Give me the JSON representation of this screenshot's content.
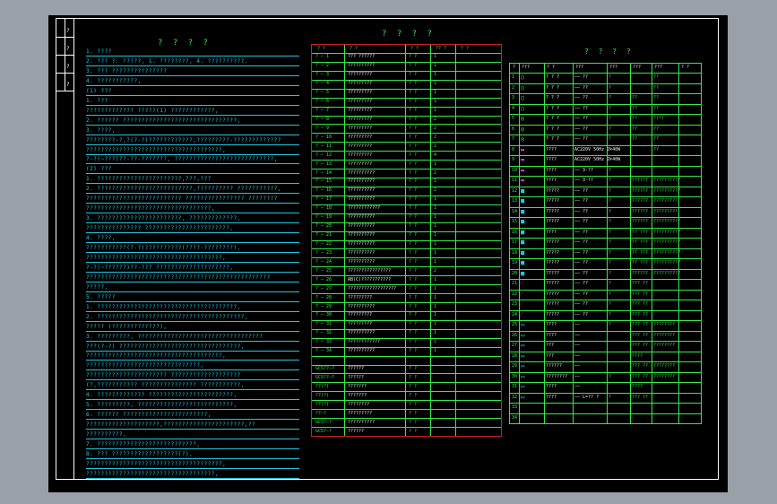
{
  "left_panel": {
    "title": "? ? ? ?",
    "side_labels": [
      "?",
      "?",
      "?",
      "?"
    ],
    "lines": [
      "1.  ????",
      "2.  ???    ?:    ?????,     1.  ????????,     4.  ??????????.",
      "3.  ???    ???????????????",
      "4.  ???????????,",
      "(1)  ???",
      "1.  ???",
      "     ????????????? ?????(1)         ????????????,",
      "2.  ??????  ???????????????????????????????,",
      "3.  ????,",
      "     ????????-?,?(?-?)????????????,?????????-?????????????",
      "     ?????????????????????????????????????,",
      "     ?-?(~???)??-??-???????,  ???????????????????????????,",
      "(2)  ???",
      "1.  ???????????????????????,???,???",
      "2.  ??????????????????????????,??????????            ???????????,",
      "     ??????????????????????????                 ????????????????       ????????",
      "     ??????????????????????????????????,",
      "3.  ???????????????????????,              ?????????????,",
      "     ???????????????         ???????????????????????,",
      "4.  ????,",
      "     ???????????(?-?)??????????(????-????????),",
      "     ?????????????????????????????????????,",
      "     ?-?(~??????)??-???     ????????????????????,",
      "     ??????????????????????????????????????????????????",
      "     ?????,",
      "5.  ?????",
      "1.  ??????????????????????????????????????,",
      "2.  ????????????????????????????????????????,",
      "     ?????      (?????????????),",
      "3.  ?????????,        ??????????????????????????????????",
      "     ???(?-?)          ?????????????????????????????????,",
      "     ?????????????????????????????????????,",
      "     ???????????????????????????????,",
      "     ??????????????????????            ???????????????????",
      "     (?,???????????              ???????????????             ???????????,",
      "4.  ?????????????             ???????????????????????,",
      "5.  ?????????,      ??????????????????????????,",
      "6.  ??????            ???????????????????????,",
      "     ????????????????????,??????????????????????,??",
      "     ??????????,",
      "7.  ???????????????????????????,",
      "8.  ???    ??????????????????(?),",
      "     ?????????????????????????????????????,",
      "     ???????????????????????????????????,"
    ]
  },
  "middle_table": {
    "title": "? ? ? ?",
    "headers": [
      "? ?",
      "? ?",
      "? ?",
      "?? ?",
      "? ?"
    ],
    "rows": [
      [
        "? — 1",
        "???    ??????",
        "? ?",
        "1",
        ""
      ],
      [
        "? — 2",
        "??????????",
        "? ?",
        "1",
        ""
      ],
      [
        "? — 3",
        "?????????",
        "? ?",
        "1",
        ""
      ],
      [
        "? — 4",
        "?????????",
        "? ?",
        "1",
        ""
      ],
      [
        "? — 5",
        "?????????",
        "? ?",
        "1",
        ""
      ],
      [
        "? — 6",
        "?????????",
        "? ?",
        "1",
        ""
      ],
      [
        "? — 7",
        "?????????",
        "? ?",
        "1",
        ""
      ],
      [
        "? — 8",
        "?????????",
        "? ?",
        "2",
        ""
      ],
      [
        "? — 9",
        "?????????",
        "? ?",
        "2",
        ""
      ],
      [
        "? — 10",
        "?????????",
        "? ?",
        "2",
        ""
      ],
      [
        "? — 11",
        "?????????",
        "? ?",
        "2",
        ""
      ],
      [
        "? — 12",
        "?????????",
        "? ?",
        "4",
        ""
      ],
      [
        "? — 13",
        "?????????",
        "? ?",
        "1",
        ""
      ],
      [
        "? — 14",
        "??????????",
        "? ?",
        "2",
        ""
      ],
      [
        "? — 15",
        "??????????",
        "? ?",
        "1",
        ""
      ],
      [
        "? — 16",
        "??????????",
        "? ?",
        "2",
        ""
      ],
      [
        "? — 17",
        "??????????",
        "? ?",
        "1",
        ""
      ],
      [
        "? — 18",
        "????????????",
        "? ?",
        "1",
        ""
      ],
      [
        "? — 19",
        "??????????",
        "? ?",
        "1",
        ""
      ],
      [
        "? — 20",
        "??????????",
        "? ?",
        "1",
        ""
      ],
      [
        "? — 21",
        "??????????",
        "? ?",
        "1",
        ""
      ],
      [
        "? — 22",
        "??????????",
        "? ?",
        "1",
        ""
      ],
      [
        "? — 23",
        "??????????",
        "? ?",
        "1",
        ""
      ],
      [
        "? — 24",
        "??????????",
        "? ?",
        "1",
        ""
      ],
      [
        "? — 25",
        "????????????????",
        "? ?",
        "2",
        ""
      ],
      [
        "? — 26",
        "AB(C)???????????",
        "? ?",
        "1",
        ""
      ],
      [
        "? — 27",
        "??????????????????",
        "? ?",
        "1",
        ""
      ],
      [
        "? — 28",
        "?????????",
        "? ?",
        "1",
        ""
      ],
      [
        "? — 29",
        "??????????",
        "? ?",
        "1",
        ""
      ],
      [
        "? — 30",
        "?????????",
        "? ?",
        "1",
        ""
      ],
      [
        "? — 31",
        "?????????",
        "? ?",
        "1",
        ""
      ],
      [
        "? — 32",
        "??????????",
        "? ?",
        "1",
        ""
      ],
      [
        "? — 33",
        "????????????",
        "? ?",
        "1",
        ""
      ],
      [
        "? — 34",
        "??????????",
        "? ?",
        "1",
        ""
      ],
      [
        "",
        "",
        "",
        "",
        ""
      ],
      [
        "GCS??—?",
        "??????",
        "? ?",
        "",
        ""
      ],
      [
        "GCS??—?",
        "??????",
        "? ?",
        "",
        ""
      ],
      [
        "??(?)",
        "???????",
        "? ?",
        "",
        ""
      ],
      [
        "??(?)",
        "???????",
        "? ?",
        "",
        ""
      ],
      [
        "??(?)",
        "????????",
        "? ?",
        "",
        ""
      ],
      [
        "??—?",
        "?????????",
        "? ?",
        "",
        ""
      ],
      [
        "GCS?—?",
        "??????????",
        "? ?",
        "",
        ""
      ],
      [
        "GCS?—?",
        "??????",
        "? ?",
        "",
        ""
      ]
    ]
  },
  "right_table": {
    "title": "? ? ? ?",
    "headers": [
      "?",
      "???",
      "?    ?",
      "???",
      "???",
      "???",
      "???",
      "? ?"
    ],
    "rows": [
      [
        "1",
        "○",
        "? ? ?",
        "—— ??",
        "?",
        "",
        "??"
      ],
      [
        "2",
        "○",
        "? ? ?",
        "—— ??",
        "?",
        "",
        "??"
      ],
      [
        "3",
        "○",
        "? ? ?",
        "—— ??",
        "?",
        "??",
        "??"
      ],
      [
        "4",
        "○",
        "? ? ?",
        "—— ??",
        "?",
        "??",
        "??"
      ],
      [
        "5",
        "◎",
        "? ? ?",
        "—— ??",
        "?",
        "??",
        "?(?)"
      ],
      [
        "6",
        "◎",
        "? ? ?",
        "—— ??",
        "?",
        "??",
        "??"
      ],
      [
        "7",
        "◎",
        "? ? ?",
        "—— ??",
        "?",
        "??",
        "??"
      ],
      [
        "8",
        "▬",
        "????",
        "AC220V 50Hz 2×40W",
        "?",
        "",
        "??"
      ],
      [
        "9",
        "▬",
        "????",
        "AC220V 50Hz 2×40W",
        "?",
        "",
        ""
      ],
      [
        "10",
        "▬",
        "????",
        "—— 3-??",
        "?",
        "",
        ""
      ],
      [
        "11",
        "▬",
        "????",
        "—— 3-??",
        "?",
        "??????",
        "??????????"
      ],
      [
        "12",
        "■",
        "?????",
        "—— ??",
        "?",
        "??????",
        "??????????"
      ],
      [
        "13",
        "■",
        "?????",
        "—— ??",
        "?",
        "??????",
        "?????????"
      ],
      [
        "14",
        "■",
        "?????",
        "—— ??",
        "?",
        "??????",
        "?????????"
      ],
      [
        "15",
        "■",
        "?????",
        "—— ??",
        "?",
        "??????",
        "??????????"
      ],
      [
        "16",
        "■",
        "????",
        "—— ??",
        "?",
        "?? ???",
        "??????????"
      ],
      [
        "17",
        "■",
        "?????",
        "—— ??",
        "?",
        "?? ???",
        "??????????"
      ],
      [
        "18",
        "■",
        "?????",
        "—— ??",
        "?",
        "?? ???",
        "??????????"
      ],
      [
        "19",
        "■",
        "?????",
        "—— ??",
        "?",
        "?? ???",
        "??????????"
      ],
      [
        "20",
        "■",
        "?????",
        "—— ??",
        "?",
        "??????",
        "??????????"
      ],
      [
        "21",
        "⁄",
        "?????",
        "—— ??",
        "?",
        "??? ??",
        ""
      ],
      [
        "22",
        "⁄",
        "?????",
        "—— ??",
        "?",
        "??? ??",
        ""
      ],
      [
        "23",
        "⁄",
        "?????",
        "—— ??",
        "?",
        "??? ??",
        ""
      ],
      [
        "24",
        "⁄",
        "?????",
        "—— ??",
        "?",
        "??? ??",
        ""
      ],
      [
        "25",
        "▭",
        "????",
        "——",
        "?",
        "??? ??",
        "????????"
      ],
      [
        "26",
        "▭",
        "????",
        "——",
        "",
        "??? ??",
        "????????"
      ],
      [
        "27",
        "▭",
        "???",
        "——",
        "",
        "??? ??",
        "????????"
      ],
      [
        "28",
        "▭",
        "???",
        "——",
        "",
        "????",
        ""
      ],
      [
        "29",
        "▭",
        "??????",
        "——",
        "",
        "??? ??",
        "????????"
      ],
      [
        "30",
        "▭",
        "????????",
        "——",
        "?",
        "??? ??",
        "????????"
      ],
      [
        "31",
        "▭",
        "????",
        "——",
        "",
        "????",
        ""
      ],
      [
        "32",
        "▭",
        "????",
        "—— L=?? ?",
        "?",
        "??? ??",
        ""
      ],
      [
        "33",
        "",
        "",
        "",
        "",
        "",
        ""
      ],
      [
        "34",
        "",
        "",
        "",
        "",
        "",
        ""
      ]
    ]
  }
}
